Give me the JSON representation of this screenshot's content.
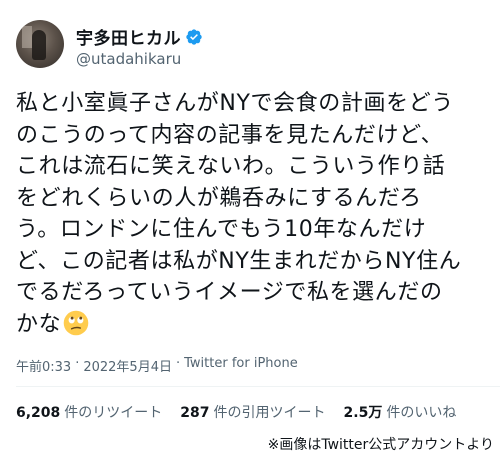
{
  "user": {
    "display_name": "宇多田ヒカル",
    "handle": "@utadahikaru"
  },
  "tweet": {
    "lines": [
      "私と小室眞子さんがNYで会食の計画をどう",
      "のこうのって内容の記事を見たんだけど、",
      "これは流石に笑えないわ。こういう作り話",
      "をどれくらいの人が鵜呑みにするんだろ",
      "う。ロンドンに住んでもう10年なんだけ",
      "ど、この記者は私がNY生まれだからNY住ん",
      "でるだろっていうイメージで私を選んだの",
      "かな"
    ],
    "emoji": "face-with-rolling-eyes-emoji"
  },
  "meta": {
    "time": "午前0:33",
    "date": "2022年5月4日",
    "client": "Twitter for iPhone"
  },
  "stats": {
    "retweets_count": "6,208",
    "retweets_label": "件のリツイート",
    "quotes_count": "287",
    "quotes_label": "件の引用ツイート",
    "likes_count": "2.5万",
    "likes_label": "件のいいね"
  },
  "source_note": "※画像はTwitter公式アカウントより",
  "colors": {
    "verified": "#1d9bf0",
    "secondary_text": "#536471",
    "primary_text": "#0f1419"
  }
}
